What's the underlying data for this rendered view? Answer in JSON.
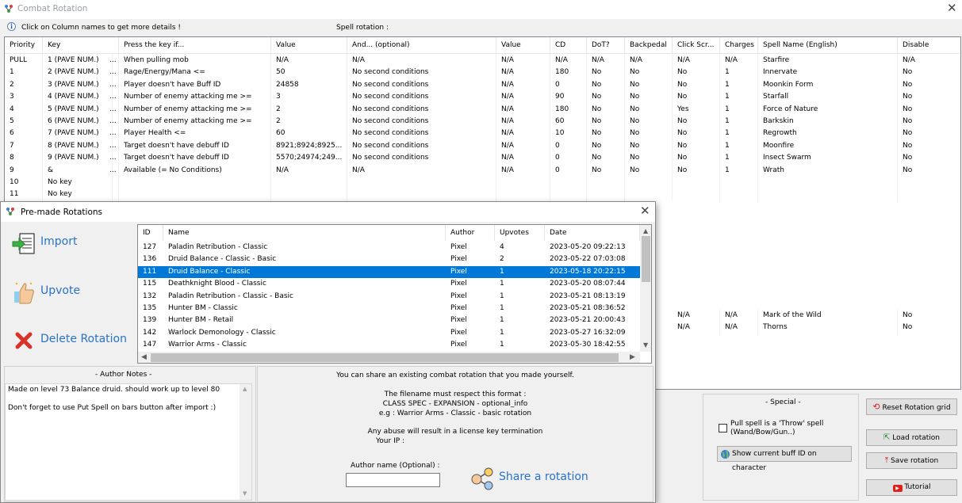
{
  "main_window": {
    "title": "Combat Rotation",
    "info_text": "Click on Column names to get more details !",
    "spell_rotation_label": "Spell rotation :"
  },
  "grid": {
    "columns": [
      "Priority",
      "Key",
      "Press the key if...",
      "Value",
      "And... (optional)",
      "Value",
      "CD",
      "DoT?",
      "Backpedal",
      "Click Scr...",
      "Charges",
      "Spell Name (English)",
      "Disable"
    ],
    "rows": [
      [
        "PULL",
        "1 (PAVE NUM.)",
        "...",
        "When pulling mob",
        "N/A",
        "N/A",
        "N/A",
        "N/A",
        "N/A",
        "N/A",
        "N/A",
        "N/A",
        "Starfire",
        "N/A"
      ],
      [
        "1",
        "2 (PAVE NUM.)",
        "...",
        "Rage/Energy/Mana <=",
        "50",
        "No second conditions",
        "N/A",
        "180",
        "No",
        "No",
        "No",
        "1",
        "Innervate",
        "No"
      ],
      [
        "2",
        "3 (PAVE NUM.)",
        "...",
        "Player doesn't have Buff ID",
        "24858",
        "No second conditions",
        "N/A",
        "0",
        "No",
        "No",
        "No",
        "1",
        "Moonkin Form",
        "No"
      ],
      [
        "3",
        "4 (PAVE NUM.)",
        "...",
        "Number of enemy attacking me >=",
        "3",
        "No second conditions",
        "N/A",
        "90",
        "No",
        "No",
        "No",
        "1",
        "Starfall",
        "No"
      ],
      [
        "4",
        "5 (PAVE NUM.)",
        "...",
        "Number of enemy attacking me >=",
        "2",
        "No second conditions",
        "N/A",
        "180",
        "No",
        "No",
        "Yes",
        "1",
        "Force of Nature",
        "No"
      ],
      [
        "5",
        "6 (PAVE NUM.)",
        "...",
        "Number of enemy attacking me >=",
        "2",
        "No second conditions",
        "N/A",
        "60",
        "No",
        "No",
        "No",
        "1",
        "Barkskin",
        "No"
      ],
      [
        "6",
        "7 (PAVE NUM.)",
        "...",
        "Player Health <=",
        "60",
        "No second conditions",
        "N/A",
        "10",
        "No",
        "No",
        "No",
        "1",
        "Regrowth",
        "No"
      ],
      [
        "7",
        "8 (PAVE NUM.)",
        "...",
        "Target doesn't have debuff ID",
        "8921;8924;8925...",
        "No second conditions",
        "N/A",
        "0",
        "No",
        "No",
        "No",
        "1",
        "Moonfire",
        "No"
      ],
      [
        "8",
        "9 (PAVE NUM.)",
        "...",
        "Target doesn't have debuff ID",
        "5570;24974;249...",
        "No second conditions",
        "N/A",
        "0",
        "No",
        "No",
        "No",
        "1",
        "Insect Swarm",
        "No"
      ],
      [
        "9",
        "&",
        "...",
        "Available (= No Conditions)",
        "N/A",
        "N/A",
        "N/A",
        "0",
        "No",
        "No",
        "No",
        "1",
        "Wrath",
        "No"
      ],
      [
        "10",
        "No key",
        "",
        "",
        "",
        "",
        "",
        "",
        "",
        "",
        "",
        "",
        "",
        ""
      ],
      [
        "11",
        "No key",
        "",
        "",
        "",
        "",
        "",
        "",
        "",
        "",
        "",
        "",
        "",
        ""
      ]
    ],
    "visible_extra_rows": [
      [
        "N/A",
        "N/A",
        "Mark of the Wild",
        "No"
      ],
      [
        "N/A",
        "N/A",
        "Thorns",
        "No"
      ]
    ]
  },
  "special": {
    "title": "- Special -",
    "throw_label": "Pull spell is a 'Throw' spell (Wand/Bow/Gun..)",
    "show_buff_label": "Show current buff ID on character",
    "throw_checked": false
  },
  "side_buttons": {
    "reset": "Reset Rotation grid",
    "load": "Load rotation",
    "save": "Save rotation",
    "tutorial": "Tutorial"
  },
  "dialog": {
    "title": "Pre-made Rotations",
    "actions": {
      "import": "Import",
      "upvote": "Upvote",
      "delete": "Delete Rotation"
    },
    "list": {
      "columns": [
        "ID",
        "Name",
        "Author",
        "Upvotes",
        "Date"
      ],
      "rows": [
        {
          "id": "127",
          "name": "Paladin Retribution - Classic",
          "author": "Pixel",
          "upvotes": "4",
          "date": "2023-05-20 09:22:13"
        },
        {
          "id": "136",
          "name": "Druid Balance - Classic - Basic",
          "author": "Pixel",
          "upvotes": "2",
          "date": "2023-05-22 07:03:08"
        },
        {
          "id": "111",
          "name": "Druid Balance - Classic",
          "author": "Pixel",
          "upvotes": "1",
          "date": "2023-05-18 20:22:15",
          "selected": true
        },
        {
          "id": "115",
          "name": "Deathknight Blood - Classic",
          "author": "Pixel",
          "upvotes": "1",
          "date": "2023-05-20 08:07:44"
        },
        {
          "id": "132",
          "name": "Paladin Retribution - Classic - Basic",
          "author": "Pixel",
          "upvotes": "1",
          "date": "2023-05-21 08:13:19"
        },
        {
          "id": "135",
          "name": "Hunter BM - Classic",
          "author": "Pixel",
          "upvotes": "1",
          "date": "2023-05-21 08:36:52"
        },
        {
          "id": "139",
          "name": "Hunter BM - Retail",
          "author": "Pixel",
          "upvotes": "1",
          "date": "2023-05-21 20:00:43"
        },
        {
          "id": "142",
          "name": "Warlock Demonology - Classic",
          "author": "Pixel",
          "upvotes": "1",
          "date": "2023-05-27 16:32:09"
        },
        {
          "id": "147",
          "name": "Warrior Arms - Classic",
          "author": "Pixel",
          "upvotes": "1",
          "date": "2023-05-30 18:42:55"
        }
      ]
    },
    "author_notes": {
      "title": "- Author Notes -",
      "lines": [
        "Made on level 73 Balance druid. should work up to level 80",
        "Don't forget to use Put Spell on bars button after import :)"
      ]
    },
    "share": {
      "line1": "You can share an existing combat rotation that you made yourself.",
      "line2": "The filename must respect this format :",
      "line3": "CLASS SPEC - EXPANSION - optional_info",
      "line4": "e.g : Warrior Arms - Classic - basic rotation",
      "line5": "Any abuse will result in a license key termination",
      "line6": "Your IP :",
      "author_label": "Author name (Optional) :",
      "author_value": "",
      "share_label": "Share a rotation"
    }
  },
  "colors": {
    "selection": "#0078d7",
    "link_blue": "#2a72c6",
    "tutorial_red": "#e0201c"
  }
}
